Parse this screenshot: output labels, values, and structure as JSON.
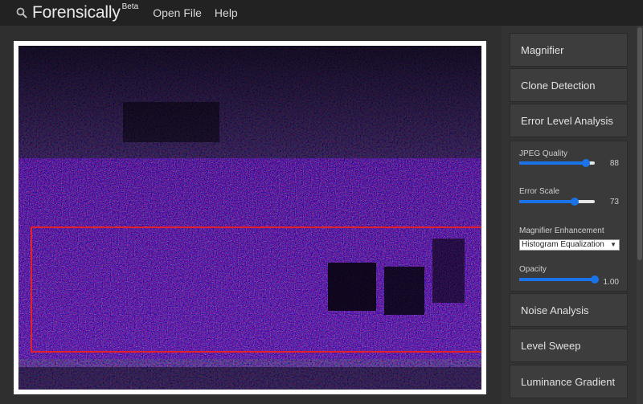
{
  "header": {
    "brand": "Forensically",
    "brand_sup": "Beta",
    "menu": [
      "Open File",
      "Help"
    ]
  },
  "tools": {
    "items": [
      "Magnifier",
      "Clone Detection",
      "Error Level Analysis",
      "Noise Analysis",
      "Level Sweep",
      "Luminance Gradient"
    ]
  },
  "ela": {
    "jpeg_quality": {
      "label": "JPEG Quality",
      "value": "88",
      "fraction": 0.88
    },
    "error_scale": {
      "label": "Error Scale",
      "value": "73",
      "fraction": 0.73
    },
    "magnifier_enhancement": {
      "label": "Magnifier Enhancement",
      "selected": "Histogram Equalization"
    },
    "opacity": {
      "label": "Opacity",
      "value": "1.00",
      "fraction": 1.0
    }
  },
  "colors": {
    "accent": "#1a73e8",
    "selection": "#e2202a",
    "background": "#2c2c2c"
  },
  "icons": {
    "logo": "magnifier-icon",
    "select": "chevron-down-icon"
  }
}
